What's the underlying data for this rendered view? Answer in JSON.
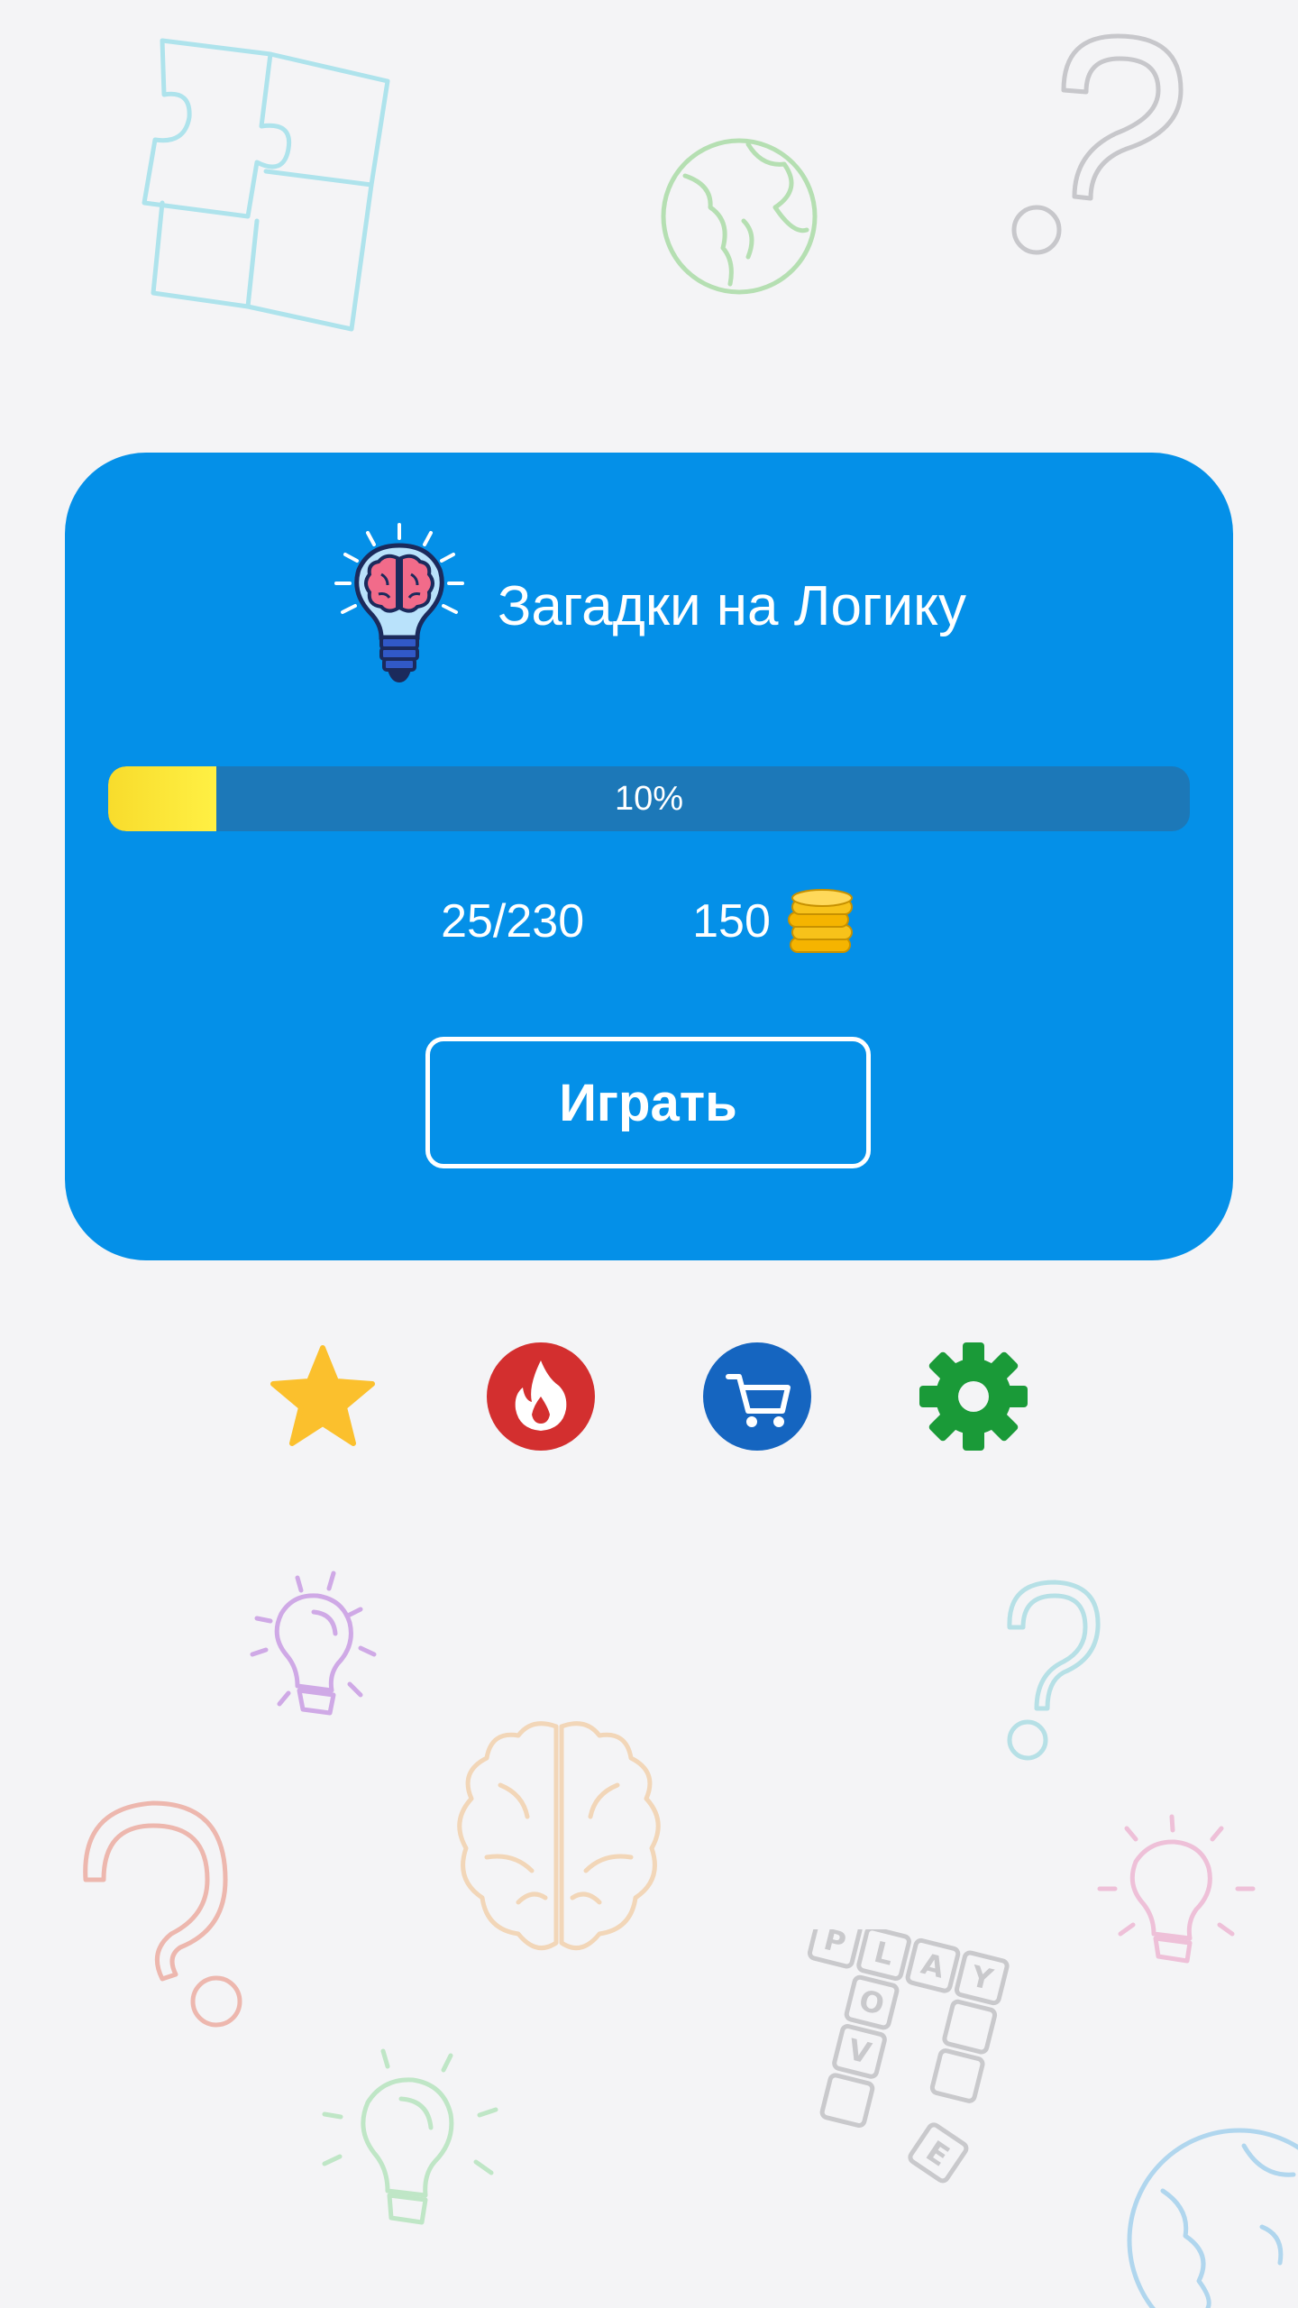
{
  "app": {
    "title": "Загадки на Логику",
    "logo_icon": "brain-lightbulb-icon"
  },
  "progress": {
    "percent": 10,
    "label": "10%"
  },
  "stats": {
    "levels_text": "25/230",
    "coins_text": "150",
    "coins_icon": "coin-stack-icon"
  },
  "play_button": {
    "label": "Играть"
  },
  "bottom_icons": [
    {
      "name": "star-icon",
      "color": "#fbc02d"
    },
    {
      "name": "fire-icon",
      "color": "#d32f2f"
    },
    {
      "name": "cart-icon",
      "color": "#1565c0"
    },
    {
      "name": "gear-icon",
      "color": "#1a9a38"
    }
  ],
  "colors": {
    "card": "#0490e8",
    "progress_track": "#1c78b8",
    "progress_fill": "#f8dc2c",
    "background": "#f4f4f6"
  },
  "background_doodles": [
    "puzzle-icon",
    "globe-icon",
    "question-mark-icon",
    "lightbulb-icon",
    "brain-icon",
    "crossword-tiles-icon"
  ],
  "crossword": {
    "letters": [
      "P",
      "L",
      "A",
      "Y",
      "O",
      "V",
      "E"
    ]
  }
}
